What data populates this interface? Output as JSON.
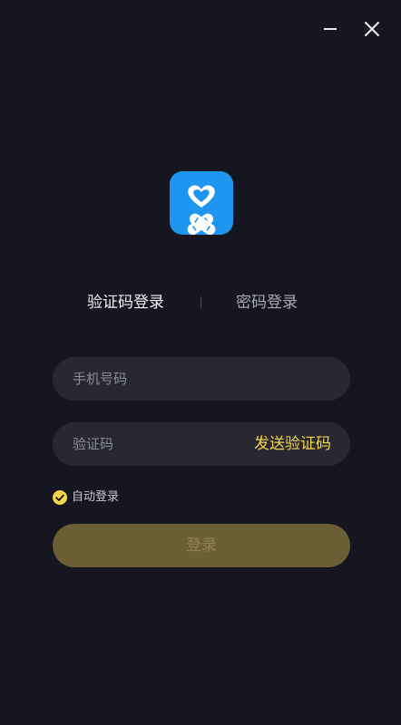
{
  "window": {
    "minimize_icon": "minimize-icon",
    "close_icon": "close-icon"
  },
  "app_icon": "heart-bandage-app-icon",
  "tabs": [
    {
      "label": "验证码登录",
      "active": true
    },
    {
      "label": "密码登录",
      "active": false
    }
  ],
  "phone": {
    "placeholder": "手机号码",
    "value": ""
  },
  "code": {
    "placeholder": "验证码",
    "value": "",
    "send_label": "发送验证码"
  },
  "auto_login": {
    "label": "自动登录",
    "checked": true
  },
  "login_button": {
    "label": "登录",
    "enabled": false
  },
  "colors": {
    "background": "#15161f",
    "field": "#272831",
    "accent": "#f5d54a",
    "button_disabled": "#6b5f35",
    "app_icon": "#1e95ee"
  }
}
